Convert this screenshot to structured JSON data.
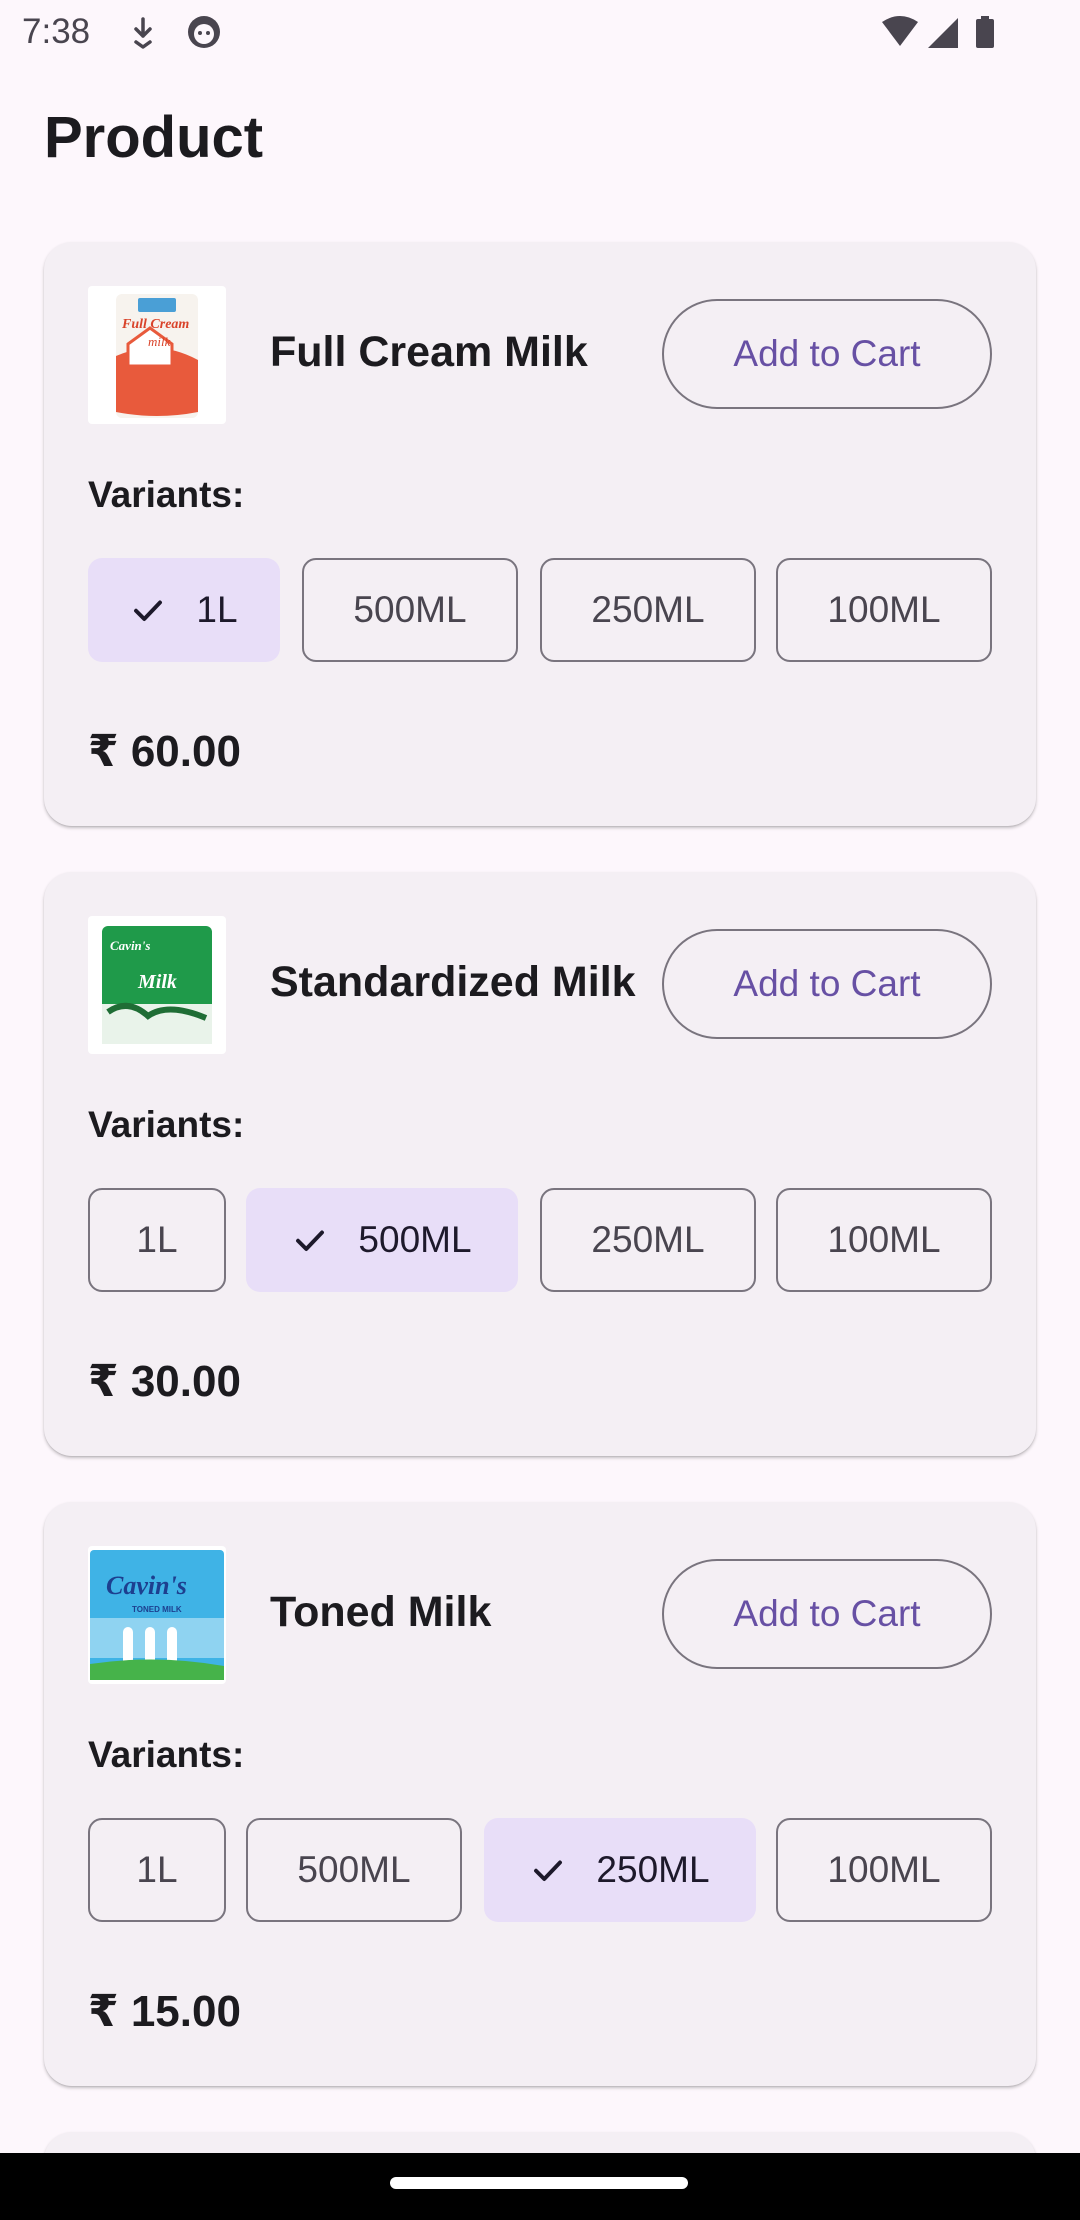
{
  "status_bar": {
    "time": "7:38",
    "icons": [
      "download-icon",
      "face-icon",
      "wifi-icon",
      "signal-icon",
      "battery-icon"
    ]
  },
  "page": {
    "title": "Product"
  },
  "labels": {
    "variants": "Variants:",
    "add_to_cart": "Add to Cart"
  },
  "products": [
    {
      "name": "Full Cream Milk",
      "image": "full-cream-milk-pack-image",
      "image_text": [
        "Full Cream",
        "milk"
      ],
      "variants": [
        "1L",
        "500ML",
        "250ML",
        "100ML"
      ],
      "selected_variant": "1L",
      "price": "₹ 60.00"
    },
    {
      "name": "Standardized Milk",
      "image": "standardized-milk-pack-image",
      "image_text": [
        "Cavin's",
        "Milk"
      ],
      "variants": [
        "1L",
        "500ML",
        "250ML",
        "100ML"
      ],
      "selected_variant": "500ML",
      "price": "₹ 30.00"
    },
    {
      "name": "Toned Milk",
      "image": "toned-milk-pack-image",
      "image_text": [
        "Cavin's",
        "TONED MILK"
      ],
      "variants": [
        "1L",
        "500ML",
        "250ML",
        "100ML"
      ],
      "selected_variant": "250ML",
      "price": "₹ 15.00"
    }
  ],
  "colors": {
    "background": "#fdf7fc",
    "card": "#f4eff4",
    "accent": "#6750a4",
    "selected_chip": "#e8def8",
    "outline": "#79747e"
  }
}
